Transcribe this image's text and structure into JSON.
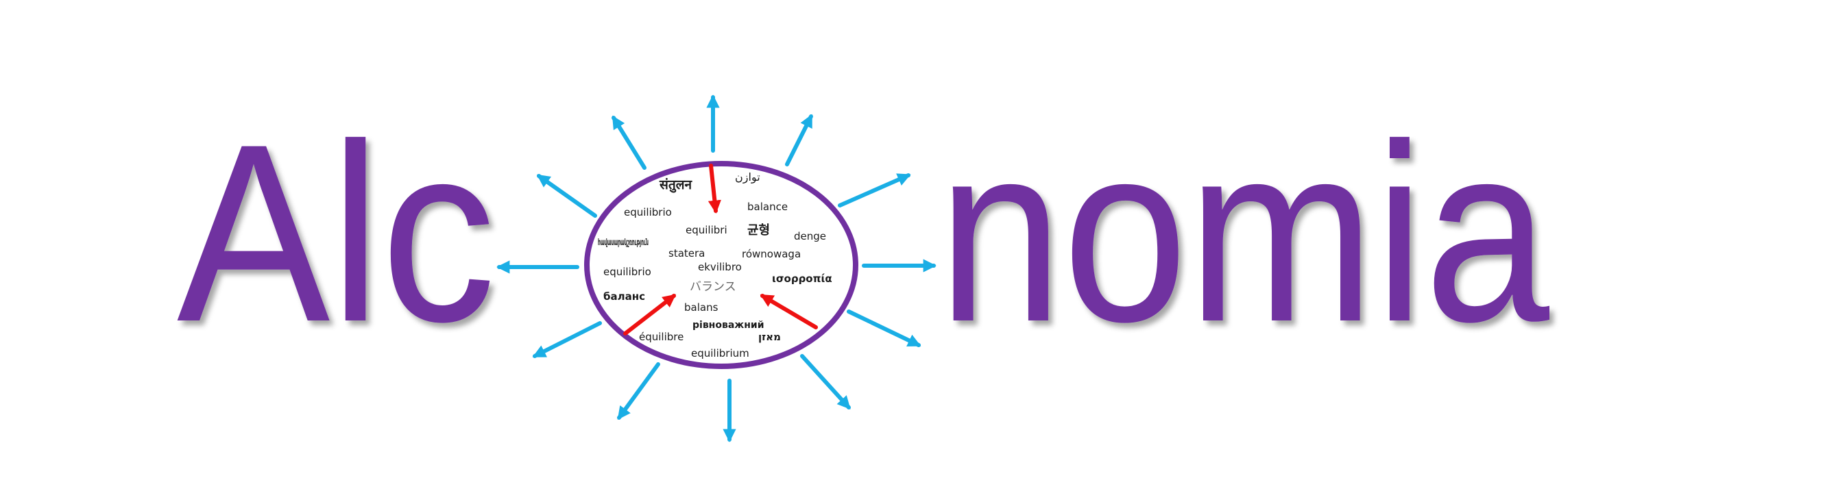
{
  "logo": {
    "left_word": "Alc",
    "right_word": "nomia",
    "text_color": "#7030a0",
    "circle_color": "#7030a0",
    "outward_arrow_color": "#1aaee5",
    "inward_arrow_color": "#ee1111",
    "words": [
      {
        "key": "hindi",
        "text": "संतुलन"
      },
      {
        "key": "arabic",
        "text": "توازن"
      },
      {
        "key": "spanish-top",
        "text": "equilibrio"
      },
      {
        "key": "english",
        "text": "balance"
      },
      {
        "key": "catalan",
        "text": "equilibri"
      },
      {
        "key": "korean",
        "text": "균형"
      },
      {
        "key": "turkish",
        "text": "denge"
      },
      {
        "key": "armenian",
        "text": "հավասարակշռություն"
      },
      {
        "key": "romanian",
        "text": "statera"
      },
      {
        "key": "polish",
        "text": "równowaga"
      },
      {
        "key": "esperanto",
        "text": "ekvilibro"
      },
      {
        "key": "spanish-mid",
        "text": "equilibrio"
      },
      {
        "key": "greek",
        "text": "ισορροπία"
      },
      {
        "key": "japanese",
        "text": "バランス"
      },
      {
        "key": "russian",
        "text": "баланс"
      },
      {
        "key": "tagalog",
        "text": "balans"
      },
      {
        "key": "ukrainian",
        "text": "рівноважний"
      },
      {
        "key": "french",
        "text": "équilibre"
      },
      {
        "key": "hebrew",
        "text": "מאזן"
      },
      {
        "key": "latin",
        "text": "equilibrium"
      }
    ]
  }
}
